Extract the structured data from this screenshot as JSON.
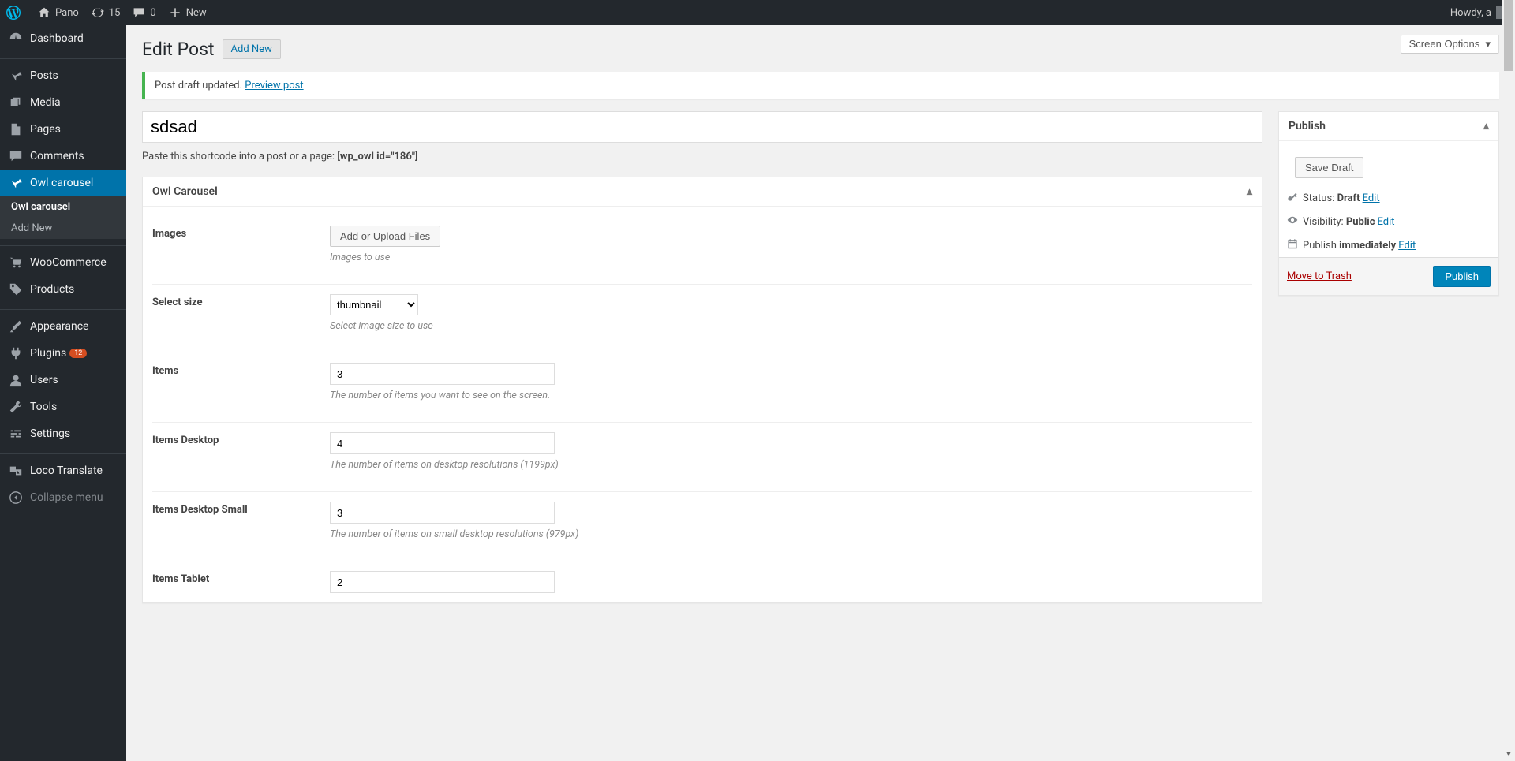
{
  "adminbar": {
    "site_name": "Pano",
    "updates_count": "15",
    "comments_count": "0",
    "new_label": "New",
    "howdy": "Howdy, a"
  },
  "sidebar": {
    "items": [
      {
        "id": "dashboard",
        "label": "Dashboard",
        "icon": "dashboard-icon"
      },
      {
        "sep": true
      },
      {
        "id": "posts",
        "label": "Posts",
        "icon": "pin-icon"
      },
      {
        "id": "media",
        "label": "Media",
        "icon": "media-icon"
      },
      {
        "id": "pages",
        "label": "Pages",
        "icon": "page-icon"
      },
      {
        "id": "comments",
        "label": "Comments",
        "icon": "comment-icon"
      },
      {
        "id": "owl",
        "label": "Owl carousel",
        "icon": "pin-icon",
        "current": true
      },
      {
        "sep": true
      },
      {
        "id": "woo",
        "label": "WooCommerce",
        "icon": "cart-icon"
      },
      {
        "id": "products",
        "label": "Products",
        "icon": "tag-icon"
      },
      {
        "sep": true
      },
      {
        "id": "appearance",
        "label": "Appearance",
        "icon": "brush-icon"
      },
      {
        "id": "plugins",
        "label": "Plugins",
        "icon": "plug-icon",
        "badge": "12"
      },
      {
        "id": "users",
        "label": "Users",
        "icon": "user-icon"
      },
      {
        "id": "tools",
        "label": "Tools",
        "icon": "wrench-icon"
      },
      {
        "id": "settings",
        "label": "Settings",
        "icon": "sliders-icon"
      },
      {
        "sep": true
      },
      {
        "id": "loco",
        "label": "Loco Translate",
        "icon": "translate-icon"
      },
      {
        "id": "collapse",
        "label": "Collapse menu",
        "icon": "collapse-icon",
        "dim": true
      }
    ],
    "submenu": {
      "parent": "owl",
      "items": [
        {
          "label": "Owl carousel",
          "current": true
        },
        {
          "label": "Add New"
        }
      ]
    }
  },
  "page": {
    "title": "Edit Post",
    "add_new": "Add New",
    "screen_options": "Screen Options"
  },
  "notice": {
    "text": "Post draft updated.",
    "link": "Preview post"
  },
  "post": {
    "title_value": "sdsad",
    "shortcode_pre": "Paste this shortcode into a post or a page: ",
    "shortcode": "[wp_owl id=\"186\"]"
  },
  "metabox": {
    "title": "Owl Carousel",
    "fields": [
      {
        "key": "images",
        "label": "Images",
        "type": "button",
        "button": "Add or Upload Files",
        "desc": "Images to use"
      },
      {
        "key": "size",
        "label": "Select size",
        "type": "select",
        "value": "thumbnail",
        "desc": "Select image size to use"
      },
      {
        "key": "items",
        "label": "Items",
        "type": "text",
        "value": "3",
        "desc": "The number of items you want to see on the screen."
      },
      {
        "key": "items_desktop",
        "label": "Items Desktop",
        "type": "text",
        "value": "4",
        "desc": "The number of items on desktop resolutions (1199px)"
      },
      {
        "key": "items_desktop_small",
        "label": "Items Desktop Small",
        "type": "text",
        "value": "3",
        "desc": "The number of items on small desktop resolutions (979px)"
      },
      {
        "key": "items_tablet",
        "label": "Items Tablet",
        "type": "text",
        "value": "2",
        "desc": ""
      }
    ]
  },
  "publish": {
    "title": "Publish",
    "save_draft": "Save Draft",
    "status_label": "Status:",
    "status_value": "Draft",
    "visibility_label": "Visibility:",
    "visibility_value": "Public",
    "schedule_label": "Publish",
    "schedule_value": "immediately",
    "edit": "Edit",
    "trash": "Move to Trash",
    "publish": "Publish"
  }
}
